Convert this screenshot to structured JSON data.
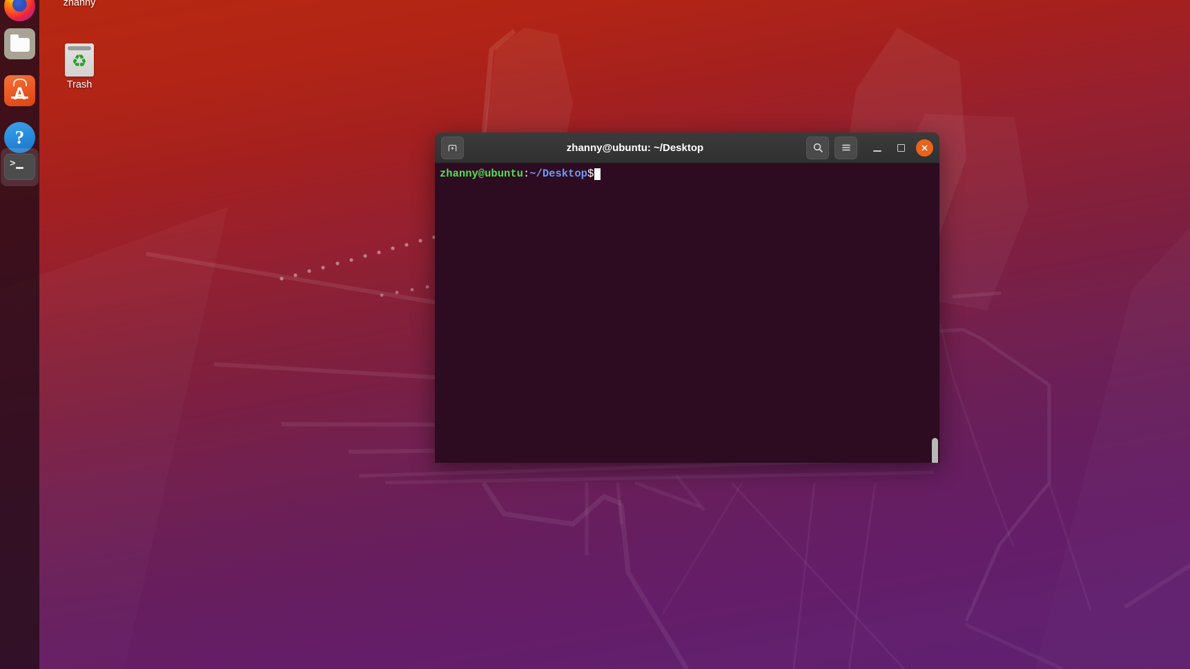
{
  "desktop": {
    "wallpaper_name": "ubuntu-focal-fossa-wallpaper",
    "colors": {
      "top": "#b62810",
      "bottom": "#5f2070",
      "dock_bg": "#260c1a",
      "accent_orange": "#e8641c"
    },
    "icons": [
      {
        "name": "zhanny",
        "label": "zhanny",
        "icon": "home-folder-icon"
      },
      {
        "name": "trash",
        "label": "Trash",
        "icon": "trash-icon"
      }
    ]
  },
  "dock": {
    "items": [
      {
        "id": "firefox",
        "label": "Firefox",
        "icon": "firefox-icon",
        "active": false
      },
      {
        "id": "files",
        "label": "Files",
        "icon": "folder-icon",
        "active": false
      },
      {
        "id": "software",
        "label": "Ubuntu Software",
        "icon": "ubuntu-software-icon",
        "active": false
      },
      {
        "id": "help",
        "label": "Help",
        "icon": "question-mark-icon",
        "active": false
      },
      {
        "id": "terminal",
        "label": "Terminal",
        "icon": "terminal-icon",
        "active": true
      }
    ]
  },
  "terminal": {
    "window_title": "zhanny@ubuntu: ~/Desktop",
    "titlebar": {
      "new_tab_label": "New Tab",
      "new_tab_icon": "new-tab-icon",
      "search_label": "Search",
      "search_icon": "search-icon",
      "menu_label": "Menu",
      "menu_icon": "hamburger-menu-icon",
      "minimize_label": "Minimize",
      "minimize_icon": "minimize-icon",
      "maximize_label": "Maximize",
      "maximize_icon": "maximize-icon",
      "close_label": "Close",
      "close_icon": "close-icon"
    },
    "prompt": {
      "user_host": "zhanny@ubuntu",
      "colon": ":",
      "path": "~/Desktop",
      "dollar": "$",
      "command": "",
      "colors": {
        "user_host": "#4ee24e",
        "path": "#6a9df8",
        "text": "#ffffff",
        "background": "#2d0b21"
      }
    },
    "scrollbar": {
      "label": "Vertical scrollbar"
    }
  }
}
